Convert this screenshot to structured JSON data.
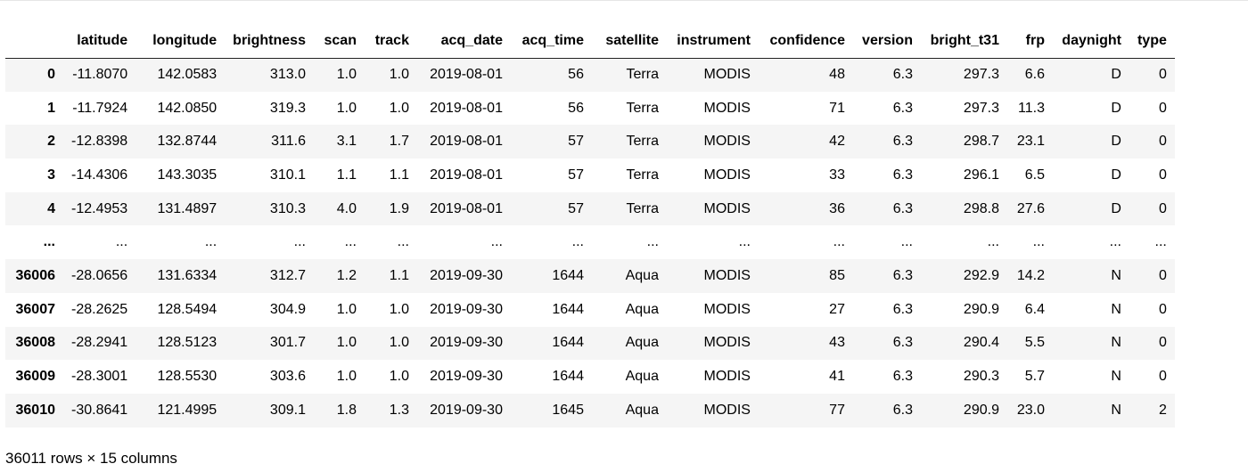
{
  "dataframe": {
    "columns": [
      "latitude",
      "longitude",
      "brightness",
      "scan",
      "track",
      "acq_date",
      "acq_time",
      "satellite",
      "instrument",
      "confidence",
      "version",
      "bright_t31",
      "frp",
      "daynight",
      "type"
    ],
    "rows": [
      {
        "index": "0",
        "cells": [
          "-11.8070",
          "142.0583",
          "313.0",
          "1.0",
          "1.0",
          "2019-08-01",
          "56",
          "Terra",
          "MODIS",
          "48",
          "6.3",
          "297.3",
          "6.6",
          "D",
          "0"
        ]
      },
      {
        "index": "1",
        "cells": [
          "-11.7924",
          "142.0850",
          "319.3",
          "1.0",
          "1.0",
          "2019-08-01",
          "56",
          "Terra",
          "MODIS",
          "71",
          "6.3",
          "297.3",
          "11.3",
          "D",
          "0"
        ]
      },
      {
        "index": "2",
        "cells": [
          "-12.8398",
          "132.8744",
          "311.6",
          "3.1",
          "1.7",
          "2019-08-01",
          "57",
          "Terra",
          "MODIS",
          "42",
          "6.3",
          "298.7",
          "23.1",
          "D",
          "0"
        ]
      },
      {
        "index": "3",
        "cells": [
          "-14.4306",
          "143.3035",
          "310.1",
          "1.1",
          "1.1",
          "2019-08-01",
          "57",
          "Terra",
          "MODIS",
          "33",
          "6.3",
          "296.1",
          "6.5",
          "D",
          "0"
        ]
      },
      {
        "index": "4",
        "cells": [
          "-12.4953",
          "131.4897",
          "310.3",
          "4.0",
          "1.9",
          "2019-08-01",
          "57",
          "Terra",
          "MODIS",
          "36",
          "6.3",
          "298.8",
          "27.6",
          "D",
          "0"
        ]
      },
      {
        "index": "...",
        "cells": [
          "...",
          "...",
          "...",
          "...",
          "...",
          "...",
          "...",
          "...",
          "...",
          "...",
          "...",
          "...",
          "...",
          "...",
          "..."
        ]
      },
      {
        "index": "36006",
        "cells": [
          "-28.0656",
          "131.6334",
          "312.7",
          "1.2",
          "1.1",
          "2019-09-30",
          "1644",
          "Aqua",
          "MODIS",
          "85",
          "6.3",
          "292.9",
          "14.2",
          "N",
          "0"
        ]
      },
      {
        "index": "36007",
        "cells": [
          "-28.2625",
          "128.5494",
          "304.9",
          "1.0",
          "1.0",
          "2019-09-30",
          "1644",
          "Aqua",
          "MODIS",
          "27",
          "6.3",
          "290.9",
          "6.4",
          "N",
          "0"
        ]
      },
      {
        "index": "36008",
        "cells": [
          "-28.2941",
          "128.5123",
          "301.7",
          "1.0",
          "1.0",
          "2019-09-30",
          "1644",
          "Aqua",
          "MODIS",
          "43",
          "6.3",
          "290.4",
          "5.5",
          "N",
          "0"
        ]
      },
      {
        "index": "36009",
        "cells": [
          "-28.3001",
          "128.5530",
          "303.6",
          "1.0",
          "1.0",
          "2019-09-30",
          "1644",
          "Aqua",
          "MODIS",
          "41",
          "6.3",
          "290.3",
          "5.7",
          "N",
          "0"
        ]
      },
      {
        "index": "36010",
        "cells": [
          "-30.8641",
          "121.4995",
          "309.1",
          "1.8",
          "1.3",
          "2019-09-30",
          "1645",
          "Aqua",
          "MODIS",
          "77",
          "6.3",
          "290.9",
          "23.0",
          "N",
          "2"
        ]
      }
    ],
    "shape_caption": "36011 rows × 15 columns"
  }
}
